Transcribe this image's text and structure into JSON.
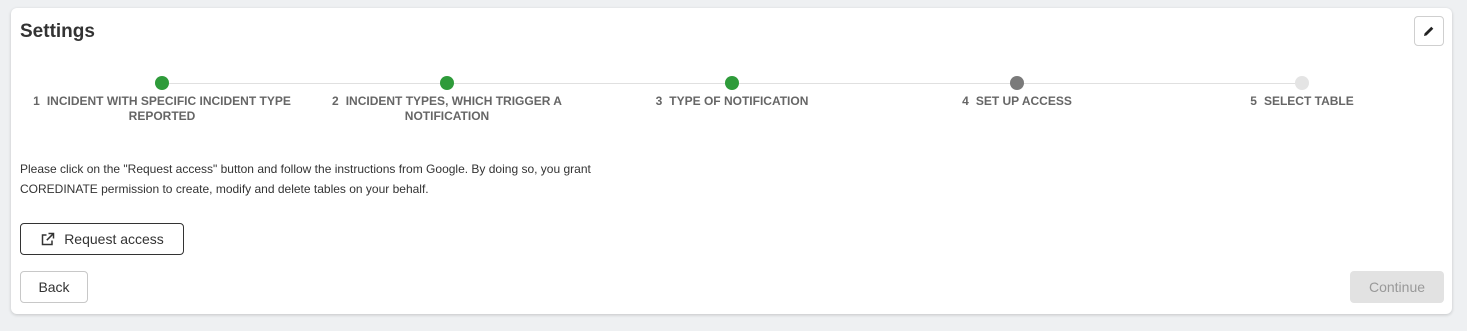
{
  "header": {
    "title": "Settings",
    "edit_icon": "pencil-icon"
  },
  "stepper": {
    "steps": [
      {
        "number": "1",
        "label": "INCIDENT WITH SPECIFIC INCIDENT TYPE REPORTED",
        "status": "completed",
        "color": "#2e9b3a"
      },
      {
        "number": "2",
        "label": "INCIDENT TYPES, WHICH TRIGGER A NOTIFICATION",
        "status": "completed",
        "color": "#2e9b3a"
      },
      {
        "number": "3",
        "label": "TYPE OF NOTIFICATION",
        "status": "completed",
        "color": "#2e9b3a"
      },
      {
        "number": "4",
        "label": "SET UP ACCESS",
        "status": "current",
        "color": "#7a7a7a"
      },
      {
        "number": "5",
        "label": "SELECT TABLE",
        "status": "upcoming",
        "color": "#e4e4e4"
      }
    ]
  },
  "content": {
    "instructions_line1": "Please click on the \"Request access\" button and follow the instructions from Google. By doing so, you grant",
    "instructions_line2": "COREDINATE permission to create, modify and delete tables on your behalf.",
    "request_access_label": "Request access",
    "request_access_icon": "external-link-icon"
  },
  "footer": {
    "back_label": "Back",
    "continue_label": "Continue",
    "continue_disabled": true
  }
}
